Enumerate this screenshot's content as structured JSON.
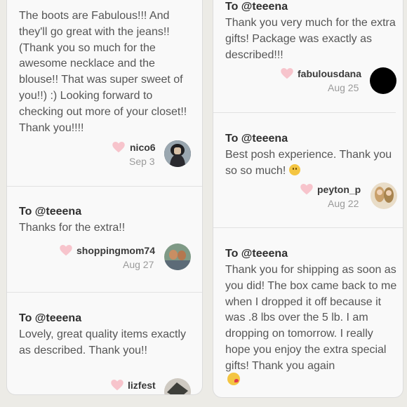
{
  "left_column": {
    "card1": {
      "message": "The boots are Fabulous!!! And they'll go great with the jeans!! (Thank you so much for the awesome necklace and the blouse!! That was super sweet of you!!) :) Looking forward to checking out more of your closet!! Thank you!!!!",
      "username": "nico6",
      "date": "Sep 3"
    },
    "card2": {
      "to": "To @teeena",
      "message": "Thanks for the extra!!",
      "username": "shoppingmom74",
      "date": "Aug 27"
    },
    "card3": {
      "to": "To @teeena",
      "message": "Lovely, great quality items exactly as described. Thank you!!",
      "username": "lizfest"
    }
  },
  "right_column": {
    "card1": {
      "to": "To @teeena",
      "message": "Thank you very much for the extra gifts! Package was exactly as described!!!",
      "username": "fabulousdana",
      "date": "Aug 25"
    },
    "card2": {
      "to": "To @teeena",
      "message": "Best posh experience. Thank you so so much!",
      "username": "peyton_p",
      "date": "Aug 22"
    },
    "card3": {
      "to": "To @teeena",
      "message": "Thank you for shipping as soon as you did! The box came back to me when I dropped it off because it was .8 lbs over the 5 lb. I am dropping on tomorrow. I really hope you enjoy the extra special gifts! Thank you again"
    }
  },
  "colors": {
    "heart": "#f7c4cc",
    "text": "#555555",
    "heading": "#2f2f2f",
    "date": "#9a9a9a",
    "card_bg": "#f9f9f9",
    "page_bg": "#ecebe6"
  },
  "icons": {
    "heart": "heart-icon",
    "smile": "smiling-face-icon",
    "kiss": "kissing-face-icon"
  }
}
